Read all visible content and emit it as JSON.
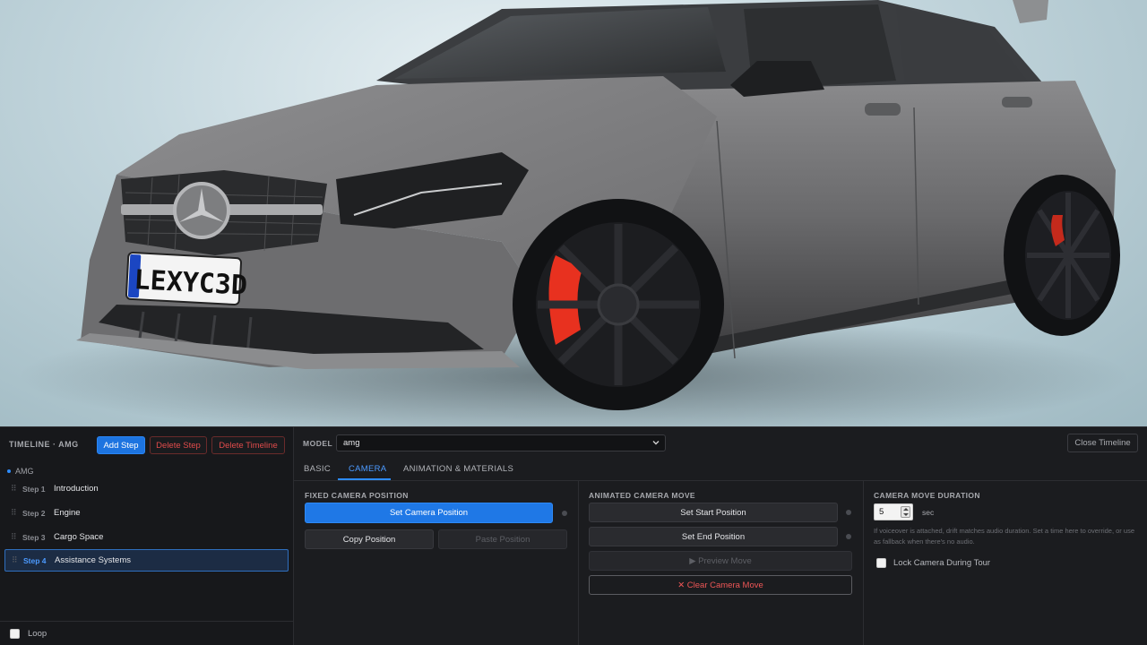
{
  "viewport": {
    "plate_text": "LEXYC3D",
    "brake_color": "#e8311f",
    "body_color": "#6a6a6c"
  },
  "timeline": {
    "title": "TIMELINE · AMG",
    "add_step": "Add Step",
    "delete_step": "Delete Step",
    "delete_timeline": "Delete Timeline",
    "root_label": "AMG",
    "steps": [
      {
        "num": "Step 1",
        "label": "Introduction",
        "active": false
      },
      {
        "num": "Step 2",
        "label": "Engine",
        "active": false
      },
      {
        "num": "Step 3",
        "label": "Cargo Space",
        "active": false
      },
      {
        "num": "Step 4",
        "label": "Assistance Systems",
        "active": true
      }
    ],
    "loop_label": "Loop"
  },
  "header": {
    "model_label": "MODEL",
    "model_value": "amg",
    "close_timeline": "Close Timeline"
  },
  "tabs": [
    {
      "label": "BASIC",
      "active": false
    },
    {
      "label": "CAMERA",
      "active": true
    },
    {
      "label": "ANIMATION & MATERIALS",
      "active": false
    }
  ],
  "fixed_camera": {
    "title": "FIXED CAMERA POSITION",
    "set_camera": "Set Camera Position",
    "copy": "Copy Position",
    "paste": "Paste Position"
  },
  "animated_camera": {
    "title": "ANIMATED CAMERA MOVE",
    "set_start": "Set Start Position",
    "set_end": "Set End Position",
    "preview": "▶ Preview Move",
    "clear": "✕ Clear Camera Move"
  },
  "duration": {
    "title": "CAMERA MOVE DURATION",
    "value": "5",
    "unit": "sec",
    "hint": "If voiceover is attached, drift matches audio duration. Set a time here to override, or use as fallback when there's no audio.",
    "lock_label": "Lock Camera During Tour"
  },
  "colors": {
    "accent": "#1d74e0",
    "danger": "#e04b4b",
    "panel_bg": "#1b1c1f"
  }
}
